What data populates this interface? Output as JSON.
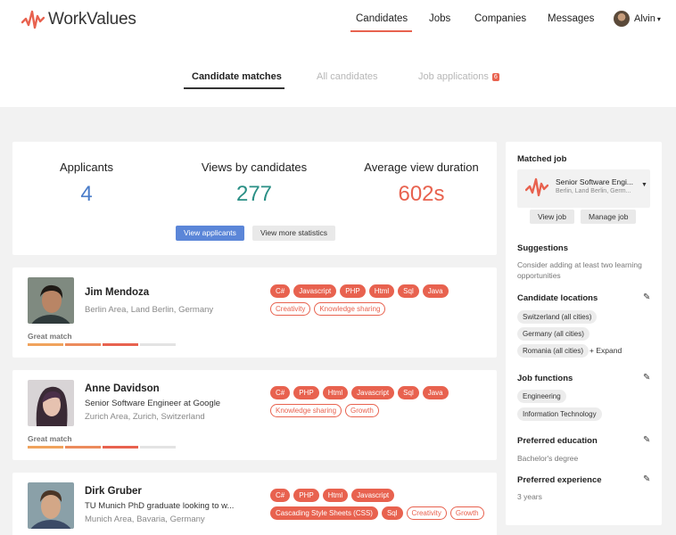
{
  "app": {
    "name": "WorkValues"
  },
  "nav": {
    "candidates": "Candidates",
    "jobs": "Jobs",
    "companies": "Companies",
    "messages": "Messages",
    "user": "Alvin"
  },
  "subtabs": {
    "matches": "Candidate matches",
    "all": "All candidates",
    "applications": "Job applications",
    "applications_badge": "6"
  },
  "stats": {
    "applicants_label": "Applicants",
    "applicants_value": "4",
    "views_label": "Views by candidates",
    "views_value": "277",
    "duration_label": "Average view duration",
    "duration_value": "602s",
    "view_applicants": "View applicants",
    "view_more": "View more statistics"
  },
  "candidates": [
    {
      "name": "Jim Mendoza",
      "headline": "",
      "location": "Berlin Area, Land Berlin, Germany",
      "match": "Great match",
      "match_level": 3,
      "tags": [
        {
          "label": "C#",
          "style": "filled"
        },
        {
          "label": "Javascript",
          "style": "filled"
        },
        {
          "label": "PHP",
          "style": "filled"
        },
        {
          "label": "Html",
          "style": "filled"
        },
        {
          "label": "Sql",
          "style": "filled"
        },
        {
          "label": "Java",
          "style": "filled"
        },
        {
          "label": "Creativity",
          "style": "outline"
        },
        {
          "label": "Knowledge sharing",
          "style": "outline"
        }
      ]
    },
    {
      "name": "Anne Davidson",
      "headline": "Senior Software Engineer at Google",
      "location": "Zurich Area, Zurich, Switzerland",
      "match": "Great match",
      "match_level": 3,
      "tags": [
        {
          "label": "C#",
          "style": "filled"
        },
        {
          "label": "PHP",
          "style": "filled"
        },
        {
          "label": "Html",
          "style": "filled"
        },
        {
          "label": "Javascript",
          "style": "filled"
        },
        {
          "label": "Sql",
          "style": "filled"
        },
        {
          "label": "Java",
          "style": "filled"
        },
        {
          "label": "Knowledge sharing",
          "style": "outline"
        },
        {
          "label": "Growth",
          "style": "outline"
        }
      ]
    },
    {
      "name": "Dirk Gruber",
      "headline": "TU Munich PhD graduate looking to w...",
      "location": "Munich Area, Bavaria, Germany",
      "match": "",
      "match_level": 0,
      "tags": [
        {
          "label": "C#",
          "style": "filled"
        },
        {
          "label": "PHP",
          "style": "filled"
        },
        {
          "label": "Html",
          "style": "filled"
        },
        {
          "label": "Javascript",
          "style": "filled"
        },
        {
          "label": "Cascading Style Sheets (CSS)",
          "style": "filled"
        },
        {
          "label": "Sql",
          "style": "filled"
        },
        {
          "label": "Creativity",
          "style": "outline"
        },
        {
          "label": "Growth",
          "style": "outline"
        }
      ]
    }
  ],
  "sidebar": {
    "matched_job_label": "Matched job",
    "job_title": "Senior Software Engi...",
    "job_location": "Berlin, Land Berlin, Germ...",
    "view_job": "View job",
    "manage_job": "Manage job",
    "suggestions_label": "Suggestions",
    "suggestion_text": "Consider adding at least two learning opportunities",
    "locations_label": "Candidate locations",
    "locations": [
      "Switzerland (all cities)",
      "Germany (all cities)",
      "Romania (all cities)"
    ],
    "expand": "Expand",
    "functions_label": "Job functions",
    "functions": [
      "Engineering",
      "Information Technology"
    ],
    "education_label": "Preferred education",
    "education_value": "Bachelor's degree",
    "experience_label": "Preferred experience",
    "experience_value": "3 years"
  },
  "colors": {
    "accent": "#e8624f",
    "blue_stat": "#4a7cc9",
    "teal_stat": "#2a8f85",
    "orange_stat": "#e8624f",
    "primary_button": "#5b86d8"
  },
  "icons": {
    "logo": "pulse-icon",
    "edit": "pencil-icon",
    "dropdown": "chevron-down-icon",
    "expand": "plus-icon"
  }
}
